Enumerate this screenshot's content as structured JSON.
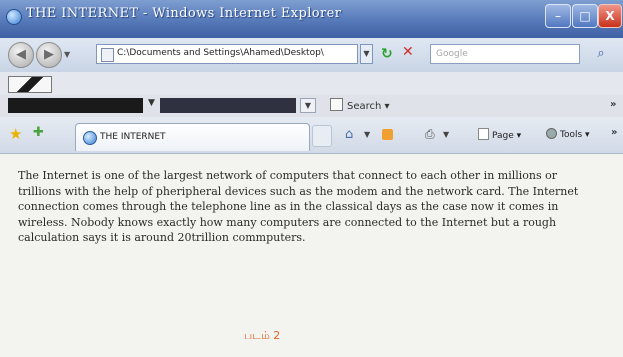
{
  "window": {
    "title": "THE INTERNET - Windows Internet Explorer",
    "controls": {
      "minimize": "–",
      "maximize": "□",
      "close": "X"
    }
  },
  "address_bar": {
    "url": "C:\\Documents and Settings\\Ahamed\\Desktop\\",
    "search_placeholder": "Google",
    "search_icon": "magnifier-icon"
  },
  "toolbar": {
    "search_label": "Search",
    "more": "»"
  },
  "tab_bar": {
    "tab_title": "THE INTERNET",
    "page_label": "Page",
    "tools_label": "Tools",
    "more": "»"
  },
  "content": {
    "paragraph": "The Internet is one of the largest network of computers that connect to each other in millions or trillions with the help of pheripheral devices such as the modem and the network card. The Internet connection comes through the telephone line as in the classical days as the case now it comes in wireless. Nobody knows exactly how many computers are connected to the Internet but a rough calculation says it is around 20trillion commputers.",
    "caption": "படம் 2"
  },
  "colors": {
    "title_bar": "#5679b9",
    "close_button": "#c8321c",
    "caption_text": "#e0652a"
  }
}
